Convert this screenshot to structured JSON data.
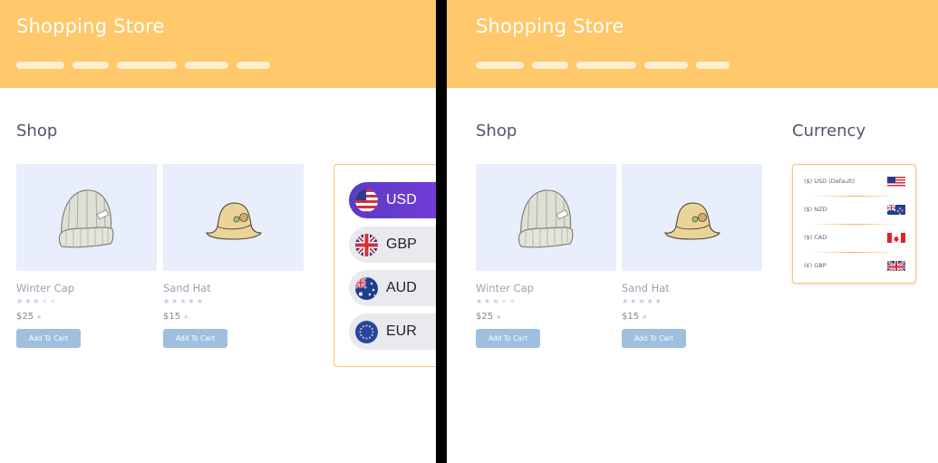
{
  "colors": {
    "header_bg": "#ffc86b",
    "accent_border": "#f7c56e",
    "product_bg": "#e8eefb",
    "button_bg": "#9ebfdd",
    "active_pill": "#6a3cd4"
  },
  "left_panel": {
    "header": {
      "title": "Shopping Store"
    },
    "shop_heading": "Shop",
    "products": [
      {
        "name": "Winter Cap",
        "price": "$25",
        "rating": 3,
        "max_rating": 5,
        "button": "Add To Cart",
        "icon": "winter-cap-image"
      },
      {
        "name": "Sand Hat",
        "price": "$15",
        "rating": 0,
        "max_rating": 5,
        "button": "Add To Cart",
        "icon": "sand-hat-image"
      }
    ],
    "currency_switcher": {
      "selected": "USD",
      "options": [
        {
          "code": "USD",
          "flag": "us-flag-icon"
        },
        {
          "code": "GBP",
          "flag": "uk-flag-icon"
        },
        {
          "code": "AUD",
          "flag": "au-flag-icon"
        },
        {
          "code": "EUR",
          "flag": "eu-flag-icon"
        }
      ]
    }
  },
  "right_panel": {
    "header": {
      "title": "Shopping Store"
    },
    "shop_heading": "Shop",
    "currency_heading": "Currency",
    "products": [
      {
        "name": "Winter Cap",
        "price": "$25",
        "rating": 3,
        "max_rating": 5,
        "button": "Add To Cart",
        "icon": "winter-cap-image"
      },
      {
        "name": "Sand Hat",
        "price": "$15",
        "rating": 0,
        "max_rating": 5,
        "button": "Add To Cart",
        "icon": "sand-hat-image"
      }
    ],
    "currency_list": [
      {
        "label": "($) USD (Default)",
        "flag": "us-flag-icon"
      },
      {
        "label": "($) NZD",
        "flag": "nz-flag-icon"
      },
      {
        "label": "($) CAD",
        "flag": "ca-flag-icon"
      },
      {
        "label": "(£) GBP",
        "flag": "uk-flag-icon"
      }
    ]
  }
}
